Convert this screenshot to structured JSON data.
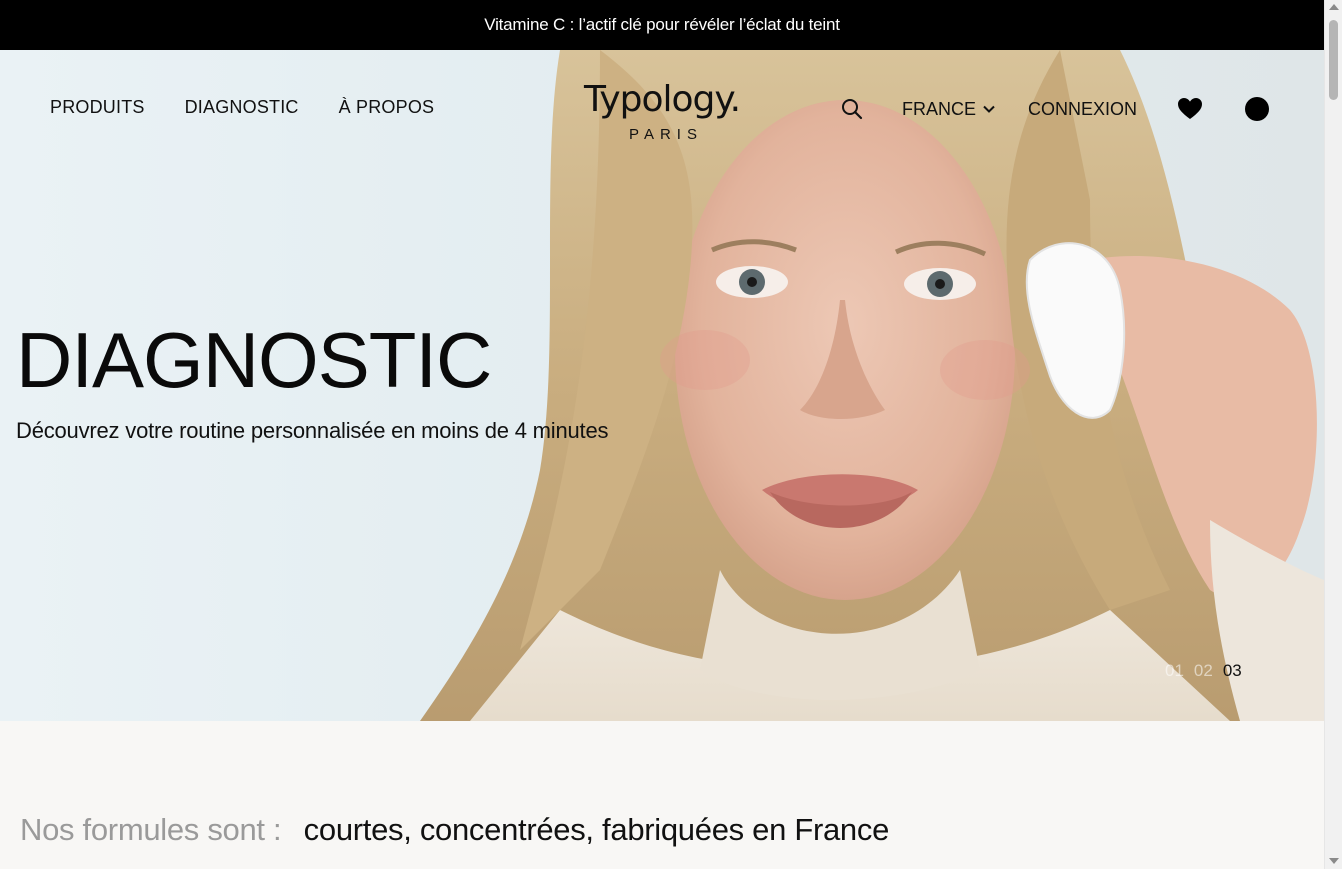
{
  "announcement": {
    "text": "Vitamine C : l’actif clé pour révéler l’éclat du teint"
  },
  "nav": {
    "links": [
      {
        "label": "PRODUITS"
      },
      {
        "label": "DIAGNOSTIC"
      },
      {
        "label": "À PROPOS"
      }
    ],
    "logo": {
      "main": "Typology.",
      "sub": "PARIS"
    },
    "country": "FRANCE",
    "login": "CONNEXION"
  },
  "icons": {
    "search": "search-icon",
    "chevron": "chevron-down-icon",
    "wishlist": "heart-icon",
    "account": "account-icon"
  },
  "hero": {
    "title": "DIAGNOSTIC",
    "subtitle": "Découvrez votre routine personnalisée en moins de 4 minutes",
    "slides": [
      "01",
      "02",
      "03"
    ],
    "active_slide": 3
  },
  "formulas": {
    "intro": "Nos formules sont :",
    "claim": "courtes, concentrées, fabriquées en France"
  },
  "colors": {
    "announcement_bg": "#000000",
    "page_bg": "#f8f7f5",
    "muted_text": "#9a9a9a"
  }
}
